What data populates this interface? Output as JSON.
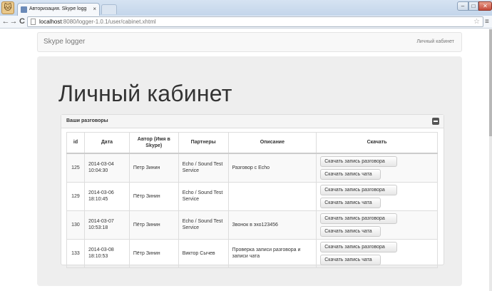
{
  "browser": {
    "avatar": "🐱",
    "tab_title": "Авторизация. Skype logg",
    "tab_close": "×",
    "url_host": "localhost",
    "url_rest": ":8080/logger-1.0.1/user/cabinet.xhtml",
    "back": "←",
    "forward": "→",
    "reload": "C",
    "minimize": "–",
    "maximize": "□",
    "close": "✕",
    "star": "☆",
    "menu": "≡"
  },
  "navbar": {
    "brand": "Skype logger",
    "link": "Личный кабинет"
  },
  "hero": {
    "title": "Личный кабинет"
  },
  "panel": {
    "title": "Ваши разговоры",
    "columns": [
      "id",
      "Дата",
      "Автор (Имя в Skype)",
      "Партнеры",
      "Описание",
      "Скачать"
    ],
    "download_conversation": "Скачать запись разговора",
    "download_chat": "Скачать запись чата",
    "rows": [
      {
        "id": "125",
        "date": "2014-03-04 10:04:30",
        "author": "Петр Зинин",
        "partners": "Echo / Sound Test Service",
        "description": "Разговор с Echo"
      },
      {
        "id": "129",
        "date": "2014-03-06 18:10:45",
        "author": "Пётр Зинин",
        "partners": "Echo / Sound Test Service",
        "description": ""
      },
      {
        "id": "130",
        "date": "2014-03-07 10:53:18",
        "author": "Пётр Зинин",
        "partners": "Echo / Sound Test Service",
        "description": "Звонок в эхо123456"
      },
      {
        "id": "133",
        "date": "2014-03-08 18:10:53",
        "author": "Пётр Зинин",
        "partners": "Виктор Сычев",
        "description": "Проверка записи разговора и записи чата"
      }
    ]
  }
}
